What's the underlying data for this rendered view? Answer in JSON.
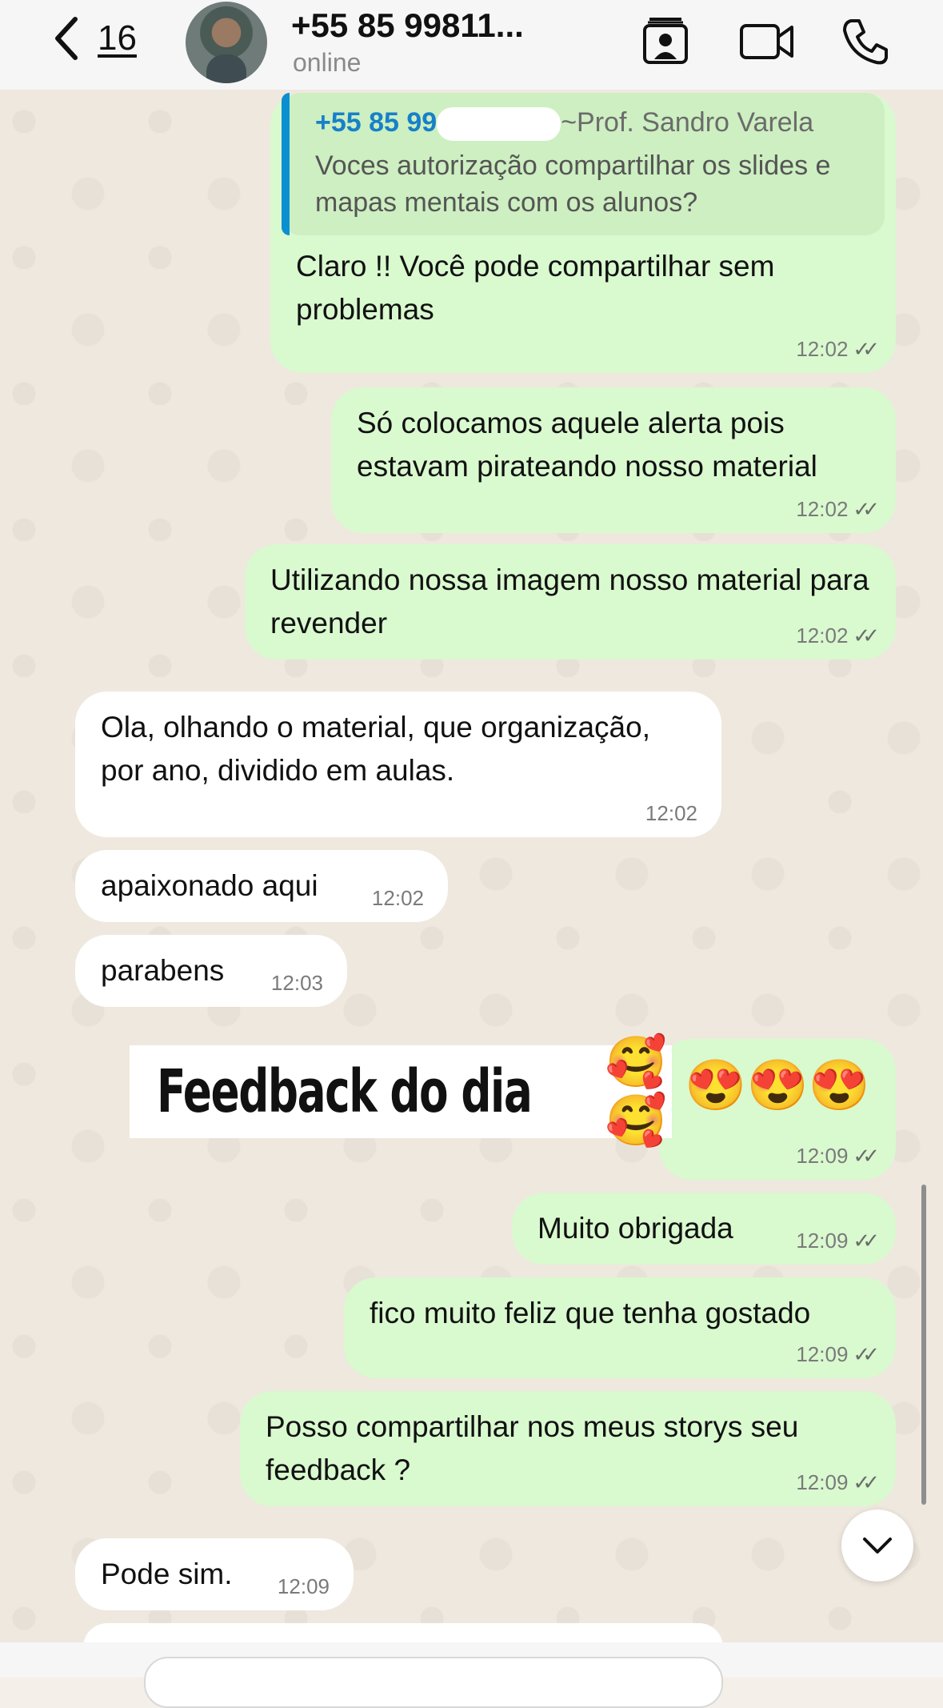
{
  "header": {
    "back_count": "16",
    "contact_name": "+55 85 99811...",
    "status": "online"
  },
  "icons": {
    "back": "chevron-left-icon",
    "contact_card": "contact-card-icon",
    "video": "video-call-icon",
    "phone": "phone-call-icon",
    "scroll_down": "chevron-down-icon",
    "read": "double-check-icon"
  },
  "messages": [
    {
      "direction": "out",
      "quote_author": "+55 85 99",
      "quote_suffix": "~Prof. Sandro Varela",
      "quote_text": "Voces autorização compartilhar os slides e mapas mentais com os alunos?",
      "text": "Claro !! Você pode compartilhar sem problemas",
      "time": "12:02"
    },
    {
      "direction": "out",
      "text": "Só colocamos aquele alerta pois estavam pirateando nosso material",
      "time": "12:02"
    },
    {
      "direction": "out",
      "text": "Utilizando nossa imagem nosso material para revender",
      "time": "12:02"
    },
    {
      "direction": "in",
      "text": "Ola, olhando o material, que organização, por ano, dividido em aulas.",
      "time": "12:02"
    },
    {
      "direction": "in",
      "text": "apaixonado aqui",
      "time": "12:02"
    },
    {
      "direction": "in",
      "text": "parabens",
      "time": "12:03"
    },
    {
      "direction": "out",
      "text": "😍😍😍",
      "time": "12:09"
    },
    {
      "direction": "out",
      "text": "Muito obrigada",
      "time": "12:09"
    },
    {
      "direction": "out",
      "text": "fico muito feliz que tenha gostado",
      "time": "12:09"
    },
    {
      "direction": "out",
      "text": "Posso compartilhar nos meus storys seu feedback ?",
      "time": "12:09"
    },
    {
      "direction": "in",
      "text": "Pode sim.",
      "time": "12:09"
    }
  ],
  "overlay": {
    "text": "Feedback do dia",
    "emojis": "🥰🥰"
  },
  "colors": {
    "outgoing_bubble": "#D9F9CF",
    "incoming_bubble": "#FFFFFF",
    "quote_bar": "#0A8FD1",
    "quote_author": "#1780C9",
    "chat_background": "#EFE8DE"
  }
}
